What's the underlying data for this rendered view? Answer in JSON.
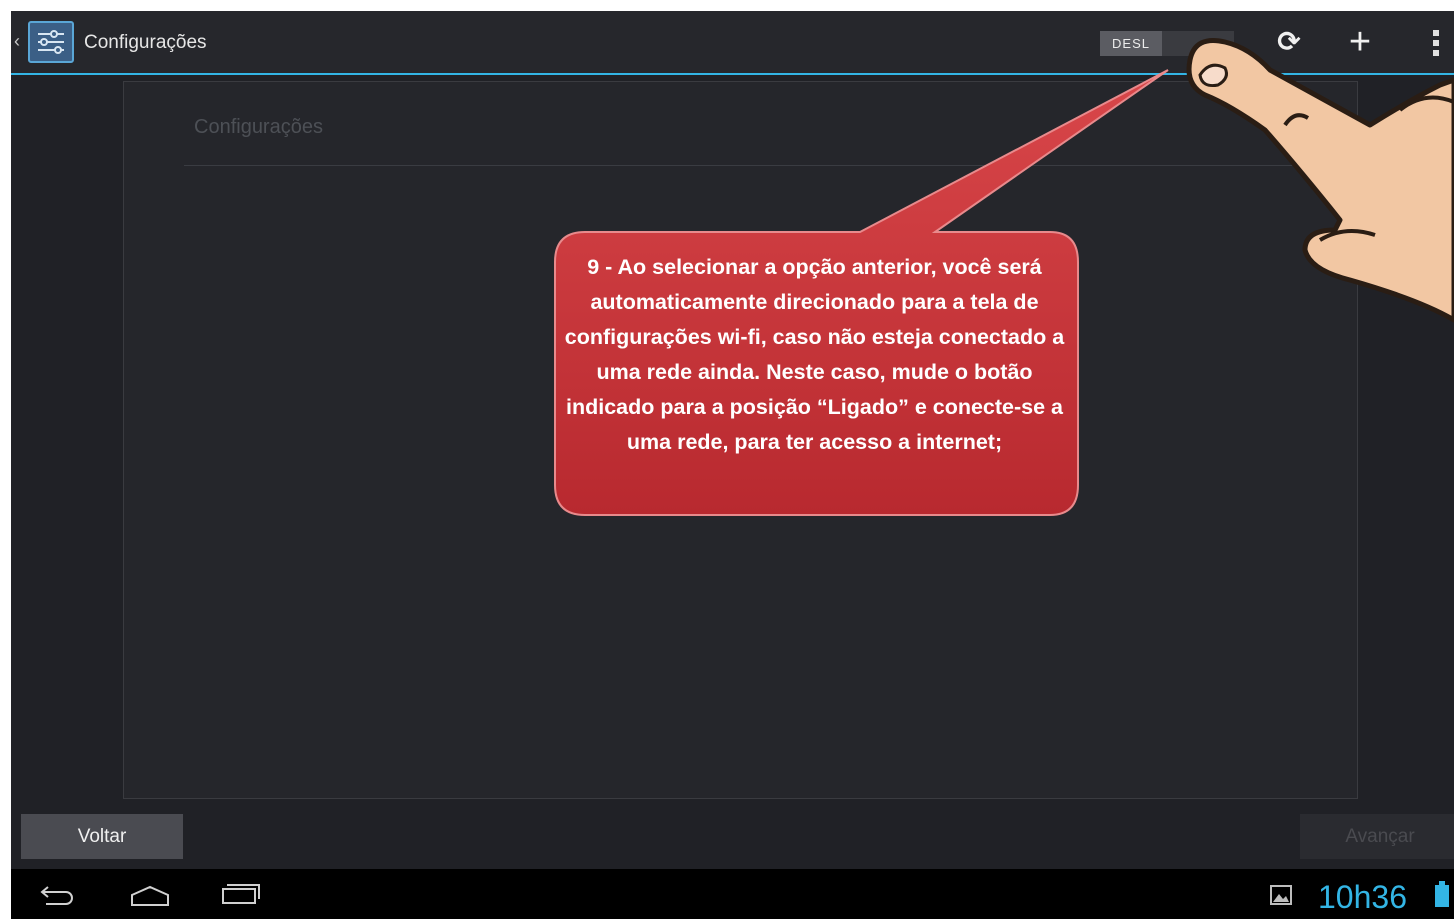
{
  "action_bar": {
    "title": "Configurações",
    "wifi_toggle_label": "DESL"
  },
  "content": {
    "heading": "Configurações"
  },
  "footer": {
    "back_label": "Voltar",
    "next_label": "Avançar"
  },
  "status_bar": {
    "time": "10h36"
  },
  "callout": {
    "text": "9 - Ao selecionar a opção anterior, você será automaticamente direcionado para a tela de configurações wi-fi, caso não esteja conectado a uma rede ainda. Neste caso, mude o botão indicado para a posição “Ligado” e conecte-se a uma rede, para ter acesso a internet;"
  },
  "colors": {
    "accent": "#33b5e5",
    "background": "#202126",
    "callout": "#c9353a"
  },
  "icons": [
    "chevron-left-icon",
    "settings-sliders-icon",
    "refresh-icon",
    "add-icon",
    "overflow-menu-icon",
    "nav-back-icon",
    "nav-home-icon",
    "nav-recent-icon",
    "gallery-icon",
    "battery-icon",
    "pointing-hand-icon"
  ]
}
